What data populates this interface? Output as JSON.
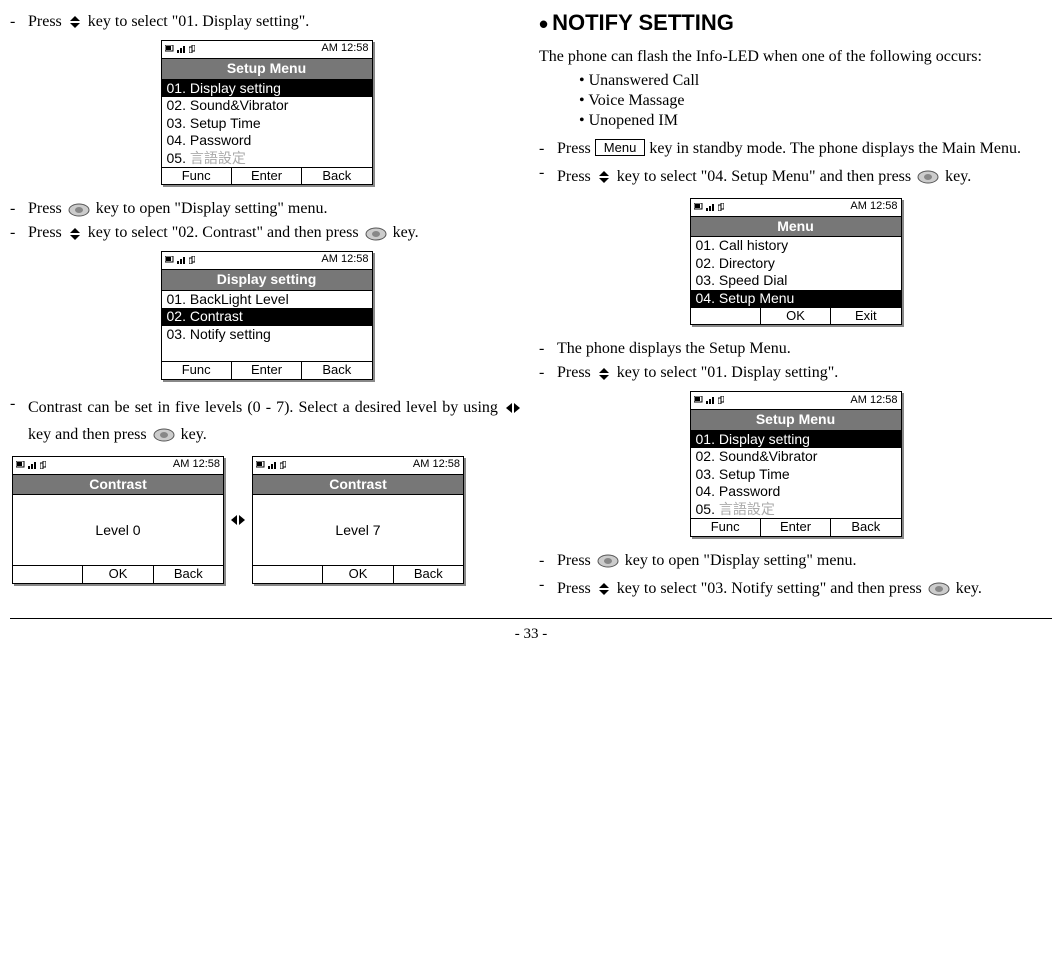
{
  "left": {
    "step1": "Press ",
    "step1b": " key to select \"01. Display setting\".",
    "step2": "Press ",
    "step2b": "  key to open \"Display setting\" menu.",
    "step3": "Press ",
    "step3b": " key to select \"02. Contrast\" and then press ",
    "step3c": " key.",
    "step4a": "Contrast can be set in five levels (0 - 7). Select a desired level by using ",
    "step4b": " key and then press ",
    "step4c": " key."
  },
  "right": {
    "heading": "NOTIFY SETTING",
    "intro": "The phone can flash the Info-LED when one of the following occurs:",
    "bul1": "Unanswered Call",
    "bul2": "Voice Massage",
    "bul3": "Unopened IM",
    "r1a": "Press ",
    "r1b": " key in standby mode. The phone displays the Main Menu.",
    "r2a": "Press ",
    "r2b": " key to select \"04. Setup Menu\" and then press ",
    "r2c": "  key.",
    "r3": "The phone displays the Setup Menu.",
    "r4a": "Press ",
    "r4b": " key to select \"01. Display setting\".",
    "r5a": "Press ",
    "r5b": " key to open \"Display setting\" menu.",
    "r6a": "Press ",
    "r6b": " key to select \"03. Notify setting\" and then press ",
    "r6c": " key."
  },
  "menuKey": "Menu",
  "time": "AM 12:58",
  "screens": {
    "setup": {
      "title": "Setup Menu",
      "i1": "01. Display setting",
      "i2": "02. Sound&Vibrator",
      "i3": "03. Setup Time",
      "i4": "04. Password",
      "i5": "05. 言語設定",
      "sk1": "Func",
      "sk2": "Enter",
      "sk3": "Back"
    },
    "display": {
      "title": "Display setting",
      "i1": "01. BackLight Level",
      "i2": "02. Contrast",
      "i3": "03. Notify setting",
      "sk1": "Func",
      "sk2": "Enter",
      "sk3": "Back"
    },
    "contrast0": {
      "title": "Contrast",
      "val": "Level 0",
      "sk2": "OK",
      "sk3": "Back"
    },
    "contrast7": {
      "title": "Contrast",
      "val": "Level 7",
      "sk2": "OK",
      "sk3": "Back"
    },
    "mainmenu": {
      "title": "Menu",
      "i1": "01. Call history",
      "i2": "02. Directory",
      "i3": "03. Speed Dial",
      "i4": "04. Setup Menu",
      "sk2": "OK",
      "sk3": "Exit"
    }
  },
  "footer": "- 33 -"
}
